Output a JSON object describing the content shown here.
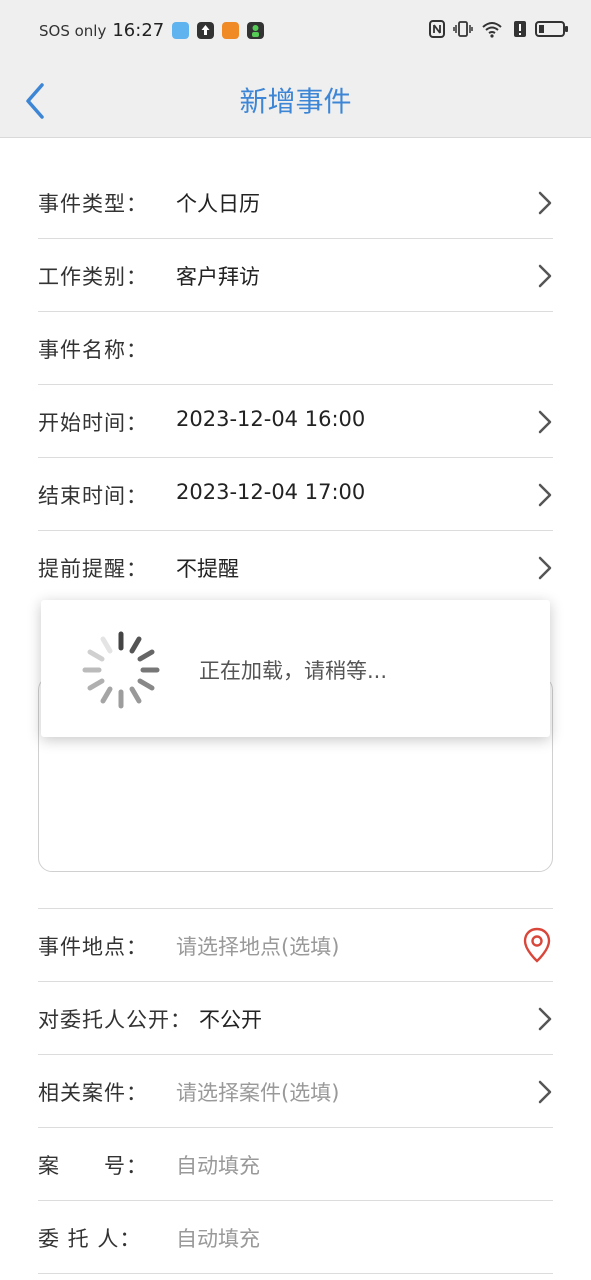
{
  "status_bar": {
    "carrier": "SOS only",
    "time": "16:27"
  },
  "nav": {
    "title": "新增事件"
  },
  "rows": [
    {
      "label": "事件类型：",
      "value": "个人日历",
      "arrow": true
    },
    {
      "label": "工作类别：",
      "value": "客户拜访",
      "arrow": true
    },
    {
      "label": "事件名称：",
      "value": "",
      "arrow": false
    },
    {
      "label": "开始时间：",
      "value": "2023-12-04 16:00",
      "arrow": true
    },
    {
      "label": "结束时间：",
      "value": "2023-12-04 17:00",
      "arrow": true
    },
    {
      "label": "提前提醒：",
      "value": "不提醒",
      "arrow": true
    }
  ],
  "lower_rows": [
    {
      "label": "事件地点：",
      "value": "请选择地点(选填)",
      "placeholder": true,
      "icon": "location-pin-icon"
    },
    {
      "label": "对委托人公开：",
      "value": "不公开",
      "placeholder": false,
      "icon": "chevron-right-icon"
    },
    {
      "label": "相关案件：",
      "value": "请选择案件(选填)",
      "placeholder": true,
      "icon": "chevron-right-icon"
    },
    {
      "label": "案　　号：",
      "value": "自动填充",
      "placeholder": true,
      "icon": ""
    },
    {
      "label": "委 托 人：",
      "value": "自动填充",
      "placeholder": true,
      "icon": ""
    }
  ],
  "loading": {
    "text": "正在加载，请稍等..."
  },
  "colors": {
    "accent": "#3d86d6",
    "pin": "#d9473b",
    "bar_bg": "#efefef"
  }
}
